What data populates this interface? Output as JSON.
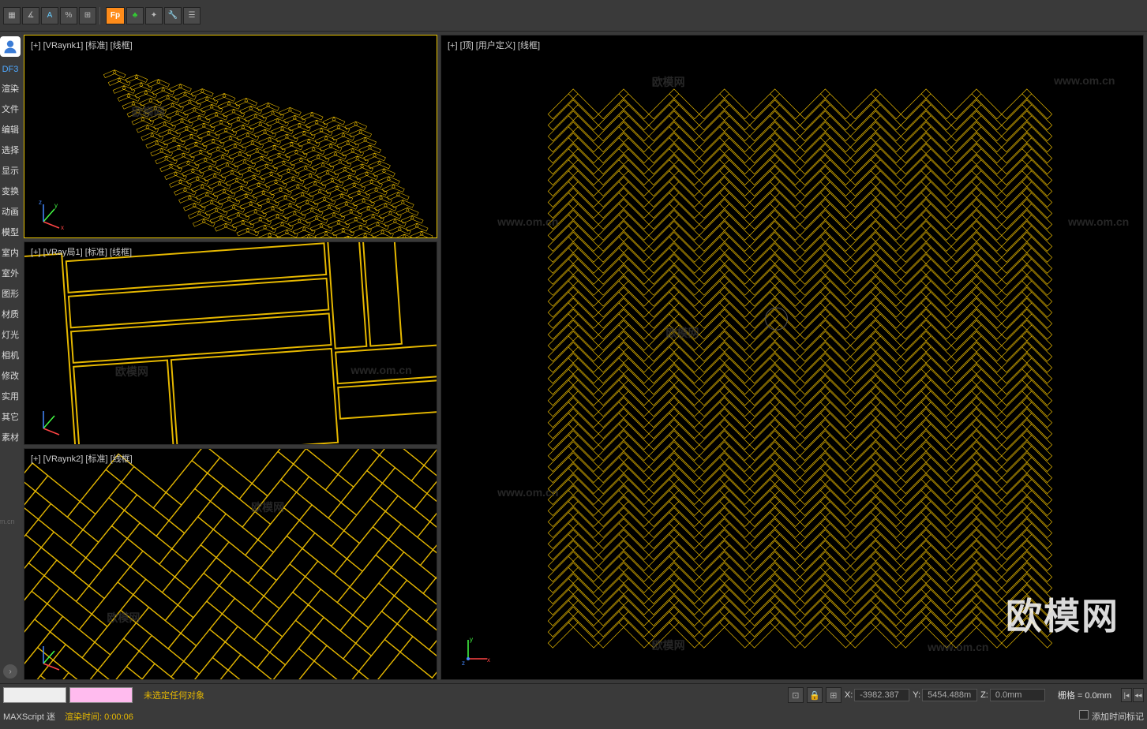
{
  "toolbar": {
    "icons": [
      "grid",
      "snap",
      "axis",
      "dot",
      "sep",
      "fp",
      "tree",
      "tool",
      "wrench",
      "list"
    ],
    "fp_label": "Fp"
  },
  "sidebar": {
    "profile": "DF3",
    "items": [
      "渲染",
      "文件",
      "编辑",
      "选择",
      "显示",
      "变换",
      "动画",
      "模型",
      "室内",
      "室外",
      "图形",
      "材质",
      "灯光",
      "相机",
      "修改",
      "实用",
      "其它",
      "素材"
    ],
    "watermark": "om.cn"
  },
  "viewports": {
    "tl": {
      "label": "[+] [VRaynk1] [标准] [线框]"
    },
    "ml": {
      "label": "[+] [VRay局1] [标准] [线框]"
    },
    "bl": {
      "label": "[+] [VRaynk2] [标准] [线框]"
    },
    "r": {
      "label": "[+] [顶] [用户定义] [线框]"
    }
  },
  "watermarks": {
    "cn": "欧模网",
    "url": "www.om.cn",
    "big": "欧模网"
  },
  "status": {
    "selection": "未选定任何对象",
    "time_label": "渲染时间",
    "time_value": "0:00:06",
    "script": "MAXScript 迷",
    "coords": {
      "x": "-3982.387",
      "y": "5454.488m",
      "z": "0.0mm"
    },
    "grid": "栅格 = 0.0mm",
    "tag_checkbox": "添加时间标记"
  }
}
